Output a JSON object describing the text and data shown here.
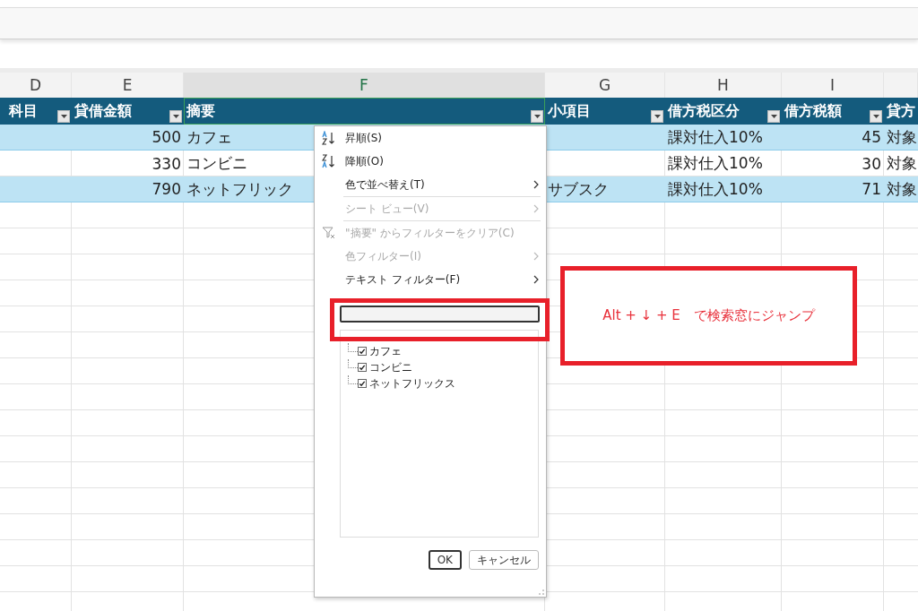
{
  "sheet": {
    "column_letters": [
      {
        "label": "D",
        "selected": false
      },
      {
        "label": "E",
        "selected": false
      },
      {
        "label": "F",
        "selected": true
      },
      {
        "label": "G",
        "selected": false
      },
      {
        "label": "H",
        "selected": false
      },
      {
        "label": "I",
        "selected": false
      }
    ],
    "headers": [
      "科目",
      "貸借金額",
      "摘要",
      "小項目",
      "借方税区分",
      "借方税額",
      "貸方"
    ],
    "rows": [
      {
        "banded": true,
        "cells": [
          "",
          "500",
          "カフェ",
          "",
          "課対仕入10%",
          "45",
          "対象"
        ]
      },
      {
        "banded": false,
        "cells": [
          "",
          "330",
          "コンビニ",
          "",
          "課対仕入10%",
          "30",
          "対象"
        ]
      },
      {
        "banded": true,
        "cells": [
          "",
          "790",
          "ネットフリック",
          "サブスク",
          "課対仕入10%",
          "71",
          "対象"
        ]
      }
    ]
  },
  "filter_menu": {
    "items": [
      {
        "kind": "sort-asc",
        "label": "昇順(S)",
        "disabled": false
      },
      {
        "kind": "sort-desc",
        "label": "降順(O)",
        "disabled": false
      },
      {
        "kind": "submenu",
        "label": "色で並べ替え(T)",
        "disabled": false
      },
      {
        "kind": "separator"
      },
      {
        "kind": "submenu",
        "label": "シート ビュー(V)",
        "disabled": true
      },
      {
        "kind": "separator"
      },
      {
        "kind": "clear",
        "label": "\"摘要\" からフィルターをクリア(C)",
        "disabled": true
      },
      {
        "kind": "submenu",
        "label": "色フィルター(I)",
        "disabled": true
      },
      {
        "kind": "submenu",
        "label": "テキスト フィルター(F)",
        "disabled": false
      }
    ],
    "values": [
      {
        "label": "カフェ",
        "checked": true
      },
      {
        "label": "コンビニ",
        "checked": true
      },
      {
        "label": "ネットフリックス",
        "checked": true
      }
    ],
    "buttons": [
      {
        "label": "OK",
        "default": true
      },
      {
        "label": "キャンセル",
        "default": false
      }
    ]
  },
  "annotation": {
    "text": "Alt + ↓ + E　で検索窓にジャンプ"
  }
}
